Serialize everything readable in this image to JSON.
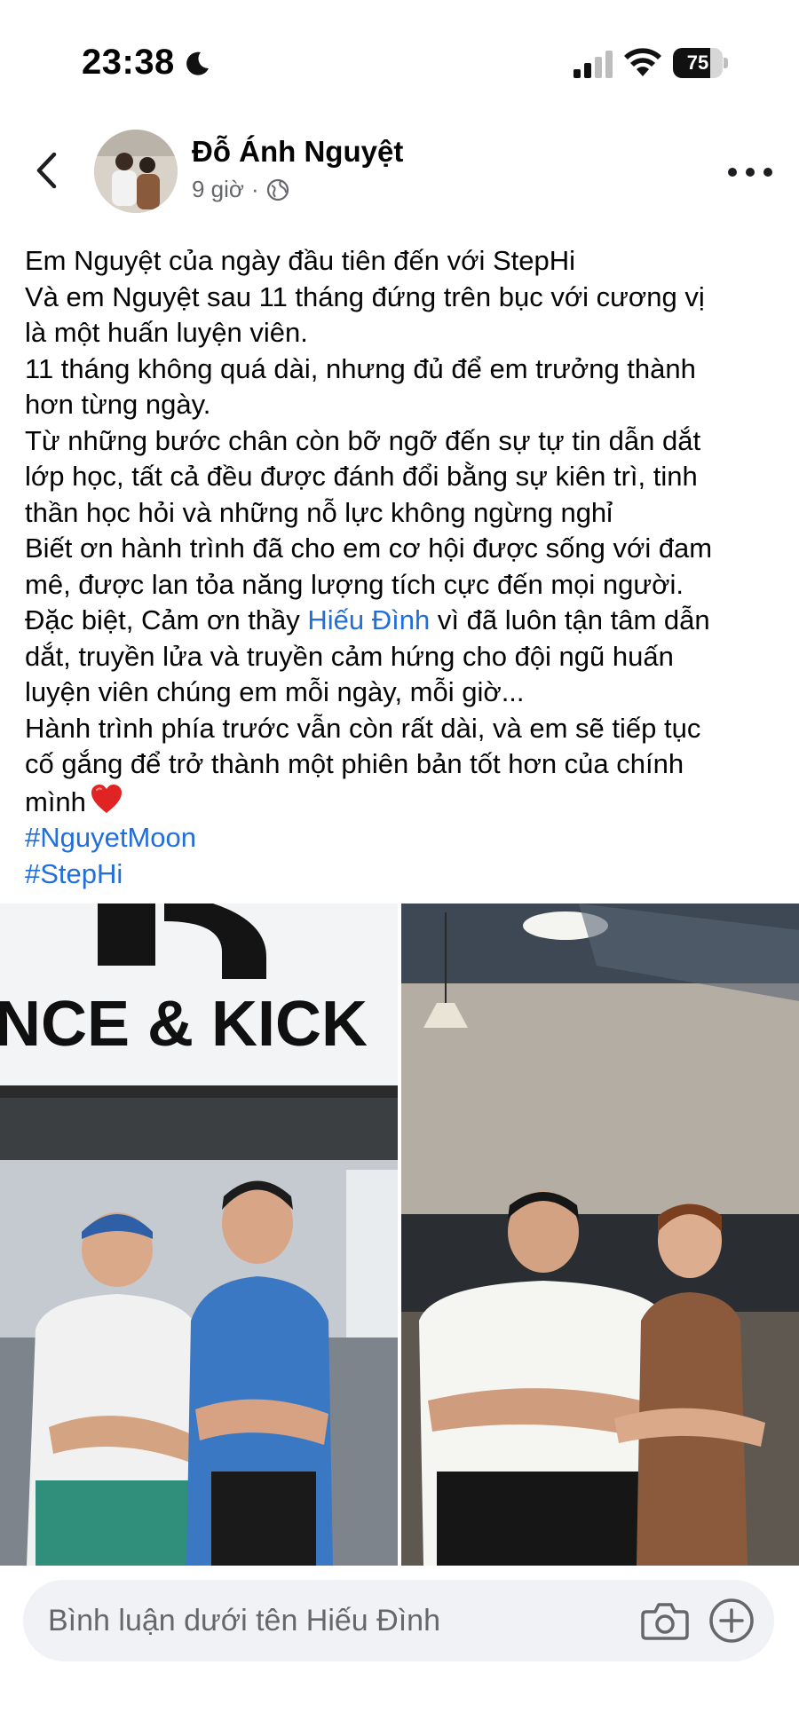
{
  "status_bar": {
    "time": "23:38",
    "moon_icon": "moon-icon",
    "battery_level": 75,
    "battery_text": "75"
  },
  "header": {
    "author_name": "Đỗ Ánh Nguyệt",
    "timestamp": "9 giờ",
    "separator": "·",
    "privacy_icon": "globe-icon",
    "back_icon": "chevron-left-icon",
    "more_icon": "more-horizontal-icon"
  },
  "post": {
    "lines": [
      "Em Nguyệt của ngày đầu tiên đến với StepHi",
      "Và em Nguyệt sau 11 tháng đứng trên bục với cương vị",
      "là một huấn luyện viên.",
      "11 tháng không quá dài, nhưng đủ để em trưởng thành",
      "hơn từng ngày.",
      "Từ những bước chân còn bỡ ngỡ đến sự tự tin dẫn dắt",
      "lớp học, tất cả đều được đánh đổi bằng sự kiên trì, tinh",
      "thần học hỏi và những nỗ lực không ngừng nghỉ",
      "Biết ơn hành trình đã cho em cơ hội được sống với đam",
      "mê, được lan tỏa năng lượng tích cực đến mọi người."
    ],
    "thanks_prefix": "Đặc biệt, Cảm ơn thầy ",
    "mention": "Hiếu Đình",
    "thanks_suffix": " vì đã luôn tận tâm dẫn",
    "lines_after": [
      "dắt, truyền lửa và truyền cảm hứng cho đội ngũ huấn",
      "luyện viên chúng em mỗi ngày, mỗi giờ...",
      "Hành trình phía trước vẫn còn rất dài, và em sẽ tiếp tục",
      "cố gắng để trở thành một phiên bản tốt hơn của chính"
    ],
    "last_line": "mình",
    "heart_icon": "red-heart-emoji-icon",
    "hashtags": [
      "#NguyetMoon",
      "#StepHi"
    ]
  },
  "photos": {
    "left_sign_text": "NCE & KICK"
  },
  "comment_bar": {
    "placeholder": "Bình luận dưới tên Hiếu Đình",
    "camera_icon": "camera-icon",
    "plus_icon": "plus-circle-icon"
  },
  "colors": {
    "link_blue": "#216fdb",
    "secondary_text": "#65676b",
    "input_bg": "#f0f2f5",
    "heart_red": "#e02424"
  }
}
